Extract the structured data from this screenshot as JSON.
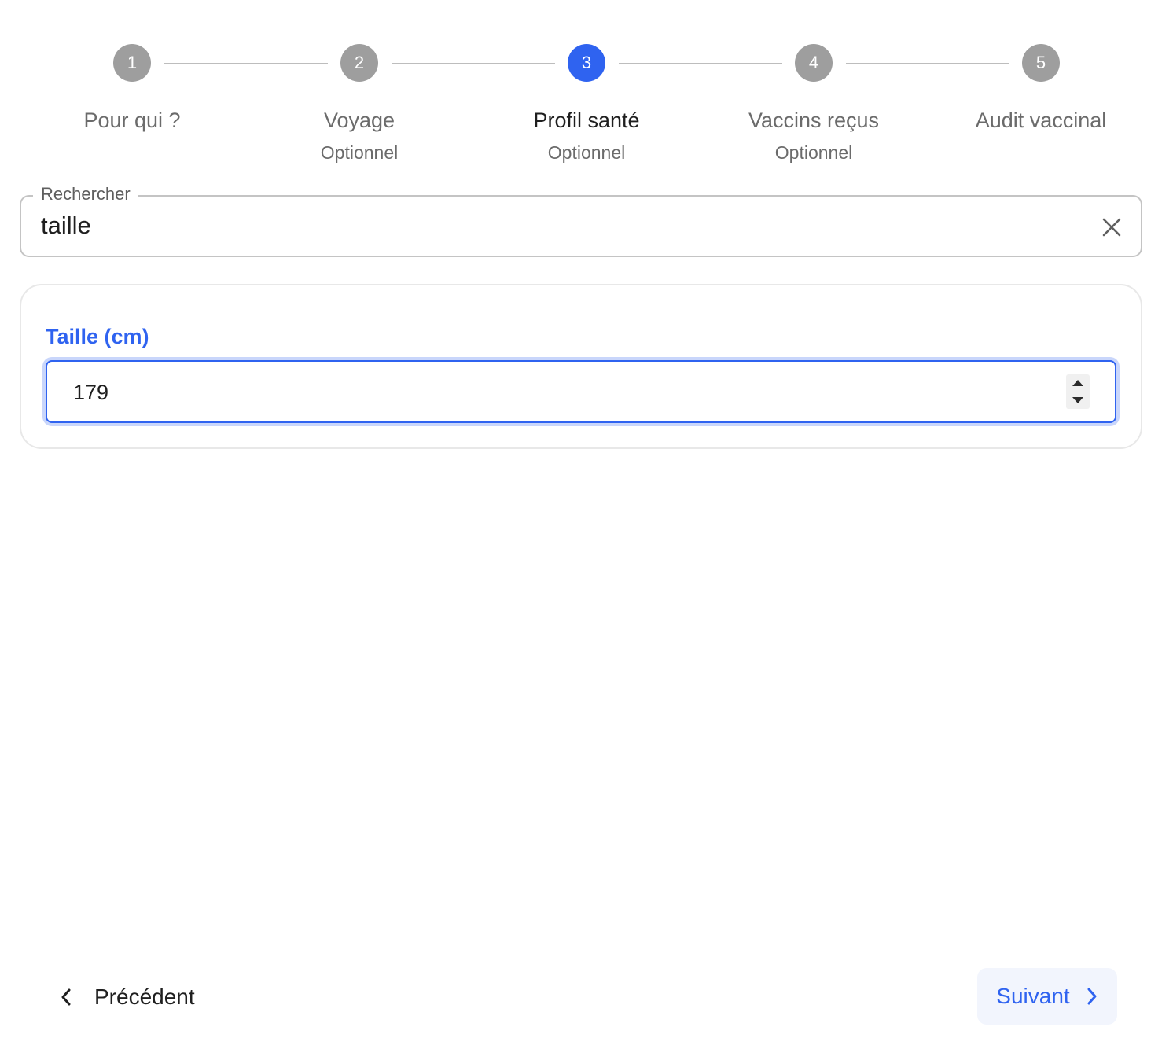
{
  "stepper": {
    "steps": [
      {
        "number": "1",
        "label": "Pour qui ?",
        "optional": ""
      },
      {
        "number": "2",
        "label": "Voyage",
        "optional": "Optionnel"
      },
      {
        "number": "3",
        "label": "Profil santé",
        "optional": "Optionnel"
      },
      {
        "number": "4",
        "label": "Vaccins reçus",
        "optional": "Optionnel"
      },
      {
        "number": "5",
        "label": "Audit vaccinal",
        "optional": ""
      }
    ],
    "active_step": 3
  },
  "search": {
    "legend": "Rechercher",
    "value": "taille",
    "clear_icon": "close-icon"
  },
  "form": {
    "height_field": {
      "label": "Taille (cm)",
      "value": "179"
    }
  },
  "navigation": {
    "prev_label": "Précédent",
    "next_label": "Suivant"
  },
  "colors": {
    "accent": "#2f63f0",
    "step_inactive": "#9e9e9e"
  }
}
